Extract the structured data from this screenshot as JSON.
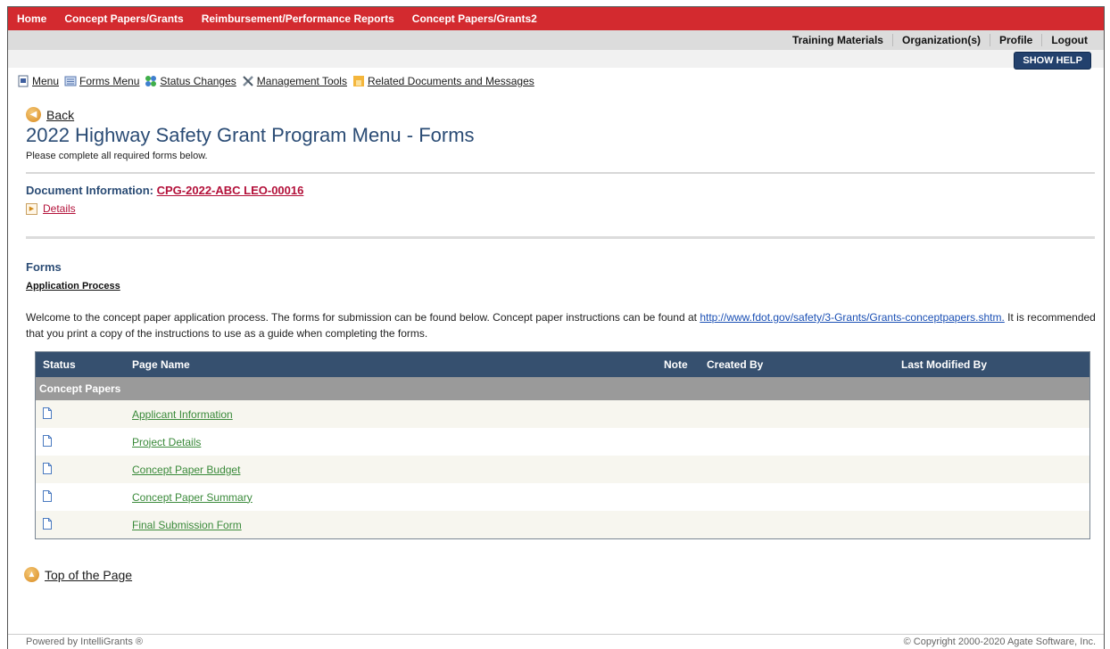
{
  "topnav": {
    "items": [
      "Home",
      "Concept Papers/Grants",
      "Reimbursement/Performance Reports",
      "Concept Papers/Grants2"
    ]
  },
  "subnav": {
    "training": "Training Materials",
    "organizations": "Organization(s)",
    "profile": "Profile",
    "logout": "Logout"
  },
  "help_button": "SHOW HELP",
  "toolbar": {
    "menu": "Menu",
    "forms_menu": "Forms Menu",
    "status_changes": "Status Changes",
    "management_tools": "Management Tools",
    "related_docs": "Related Documents and Messages"
  },
  "back_label": "Back",
  "page_title": "2022 Highway Safety Grant Program Menu - Forms",
  "instructions": "Please complete all required forms below.",
  "document_info": {
    "label": "Document Information:",
    "id": "CPG-2022-ABC LEO-00016"
  },
  "details_label": "Details",
  "forms_heading": "Forms",
  "application_heading": "Application Process",
  "welcome": {
    "before": "Welcome to the concept paper application process. The forms for submission can be found below. Concept paper instructions can be found at ",
    "link": "http://www.fdot.gov/safety/3-Grants/Grants-conceptpapers.shtm.",
    "after": " It is recommended that you print a copy of the instructions to use as a guide when completing the forms."
  },
  "table": {
    "headers": {
      "status": "Status",
      "page_name": "Page Name",
      "note": "Note",
      "created_by": "Created By",
      "last_modified_by": "Last Modified By"
    },
    "group": "Concept Papers",
    "rows": [
      {
        "name": "Applicant Information"
      },
      {
        "name": "Project Details"
      },
      {
        "name": "Concept Paper Budget"
      },
      {
        "name": "Concept Paper Summary"
      },
      {
        "name": "Final Submission Form"
      }
    ]
  },
  "top_of_page": "Top of the Page",
  "footer": {
    "left": "Powered by IntelliGrants ®",
    "right": "© Copyright 2000-2020 Agate Software, Inc."
  },
  "colors": {
    "topnav_bg": "#d32a2f",
    "title_blue": "#2b4c75",
    "table_header": "#36506f",
    "group_row": "#9a9a9a",
    "form_link": "#3a8a3a",
    "doc_link": "#b3113a"
  }
}
